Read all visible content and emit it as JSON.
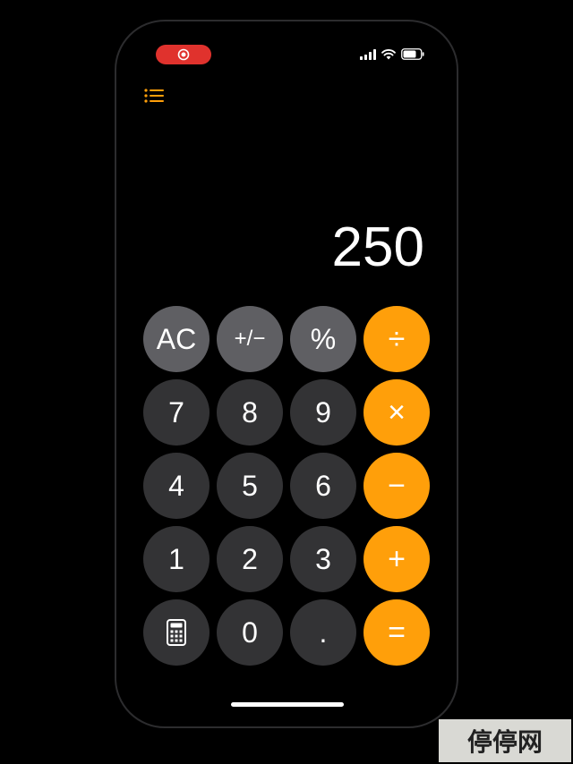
{
  "display": {
    "value": "250"
  },
  "keys": [
    {
      "id": "ac",
      "label": "AC",
      "style": "gray"
    },
    {
      "id": "plus-minus",
      "label": "+/−",
      "style": "gray"
    },
    {
      "id": "percent",
      "label": "%",
      "style": "gray"
    },
    {
      "id": "divide",
      "label": "÷",
      "style": "orange"
    },
    {
      "id": "7",
      "label": "7",
      "style": "dark"
    },
    {
      "id": "8",
      "label": "8",
      "style": "dark"
    },
    {
      "id": "9",
      "label": "9",
      "style": "dark"
    },
    {
      "id": "multiply",
      "label": "×",
      "style": "orange"
    },
    {
      "id": "4",
      "label": "4",
      "style": "dark"
    },
    {
      "id": "5",
      "label": "5",
      "style": "dark"
    },
    {
      "id": "6",
      "label": "6",
      "style": "dark"
    },
    {
      "id": "minus",
      "label": "−",
      "style": "orange"
    },
    {
      "id": "1",
      "label": "1",
      "style": "dark"
    },
    {
      "id": "2",
      "label": "2",
      "style": "dark"
    },
    {
      "id": "3",
      "label": "3",
      "style": "dark"
    },
    {
      "id": "plus",
      "label": "+",
      "style": "orange"
    },
    {
      "id": "calculator",
      "label": "",
      "style": "dark",
      "icon": "calculator-icon"
    },
    {
      "id": "0",
      "label": "0",
      "style": "dark"
    },
    {
      "id": "decimal",
      "label": ".",
      "style": "dark"
    },
    {
      "id": "equals",
      "label": "=",
      "style": "orange"
    }
  ],
  "watermark": {
    "text": "停停网"
  },
  "colors": {
    "operator": "#ff9f0a",
    "function": "#5f5f63",
    "digit": "#333335",
    "record": "#e0322d"
  },
  "icons": {
    "record": "record-icon",
    "signal": "signal-icon",
    "wifi": "wifi-icon",
    "battery": "battery-icon",
    "history": "list-icon"
  }
}
